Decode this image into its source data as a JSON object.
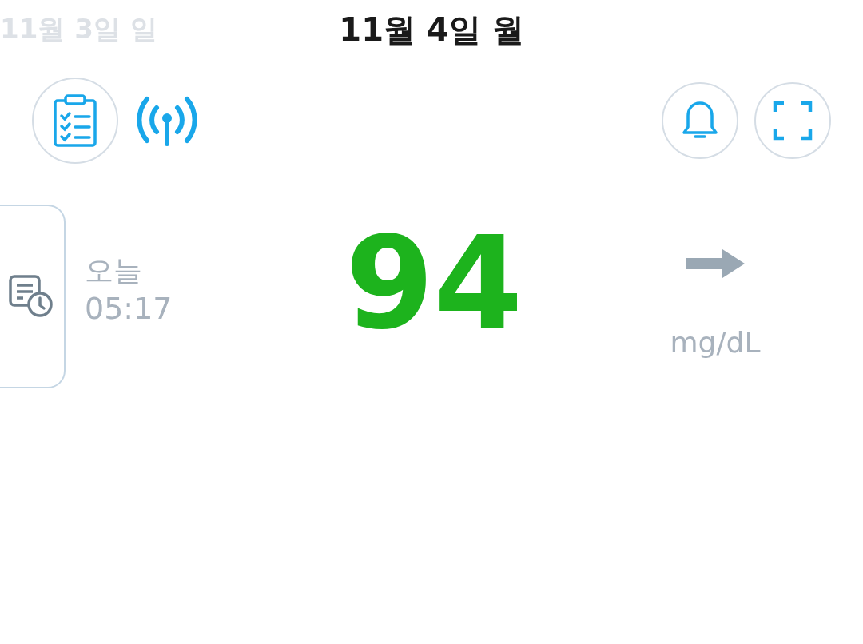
{
  "header": {
    "previous_date": "11월 3일 일",
    "current_date": "11월 4일 월"
  },
  "reading": {
    "history_label": "오늘",
    "history_time": "05:17",
    "value": "94",
    "unit": "mg/dL"
  }
}
